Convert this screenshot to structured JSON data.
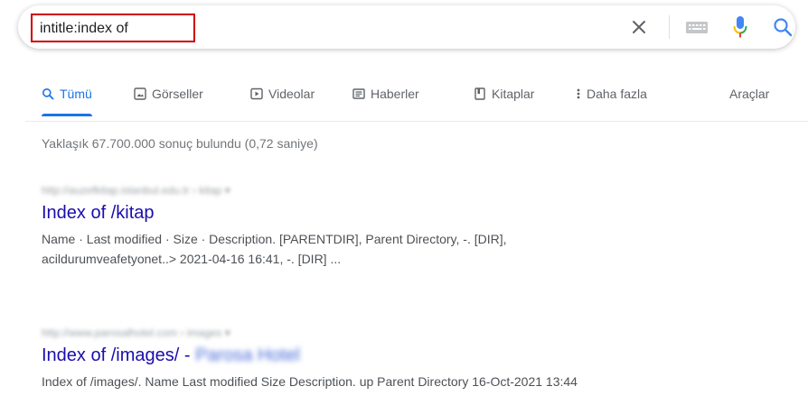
{
  "search": {
    "query": "intitle:index of"
  },
  "tabs": [
    {
      "label": "Tümü",
      "icon": "search-icon",
      "active": true
    },
    {
      "label": "Görseller",
      "icon": "image-icon",
      "active": false
    },
    {
      "label": "Videolar",
      "icon": "video-icon",
      "active": false
    },
    {
      "label": "Haberler",
      "icon": "news-icon",
      "active": false
    },
    {
      "label": "Kitaplar",
      "icon": "book-icon",
      "active": false
    },
    {
      "label": "Daha fazla",
      "icon": "more-vert-icon",
      "active": false
    }
  ],
  "tools_label": "Araçlar",
  "stats": "Yaklaşık 67.700.000 sonuç bulundu (0,72 saniye)",
  "results": [
    {
      "title": "Index of /kitap",
      "snippet_line1": "Name · Last modified · Size · Description. [PARENTDIR], Parent Directory, -. [DIR],",
      "snippet_line2": "acildurumveafetyonet..> 2021-04-16 16:41, -. [DIR] ..."
    },
    {
      "title": "Index of /images/ -",
      "snippet_line1": "Index of /images/. Name Last modified Size Description. up Parent Directory 16-Oct-2021 13:44"
    }
  ],
  "colors": {
    "link": "#1a0dab",
    "accent": "#1a73e8",
    "highlight_border": "#cc0000",
    "mic_blue": "#4285f4",
    "mic_red": "#ea4335",
    "mic_yellow": "#fbbc04",
    "mic_green": "#34a853"
  }
}
